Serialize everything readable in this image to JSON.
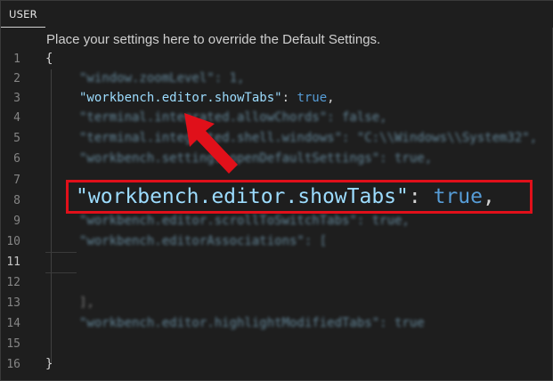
{
  "tab": {
    "label": "USER"
  },
  "hint": "Place your settings here to override the Default Settings.",
  "lines": [
    {
      "num": "1",
      "text": "{"
    },
    {
      "num": "2",
      "text": "\"window.zoomLevel\": 1,"
    },
    {
      "num": "3",
      "key": "\"workbench.editor.showTabs\"",
      "sep": ": ",
      "value": "true",
      "end": ","
    },
    {
      "num": "4",
      "text": "\"terminal.integrated.allowChords\": false,"
    },
    {
      "num": "5",
      "text": "\"terminal.integrated.shell.windows\": \"C:\\\\Windows\\\\System32\","
    },
    {
      "num": "6",
      "text": "\"workbench.settings.openDefaultSettings\": true,"
    },
    {
      "num": "7",
      "text": ""
    },
    {
      "num": "8",
      "text": ""
    },
    {
      "num": "9",
      "text": "\"workbench.editor.scrollToSwitchTabs\": true,"
    },
    {
      "num": "10",
      "text": "\"workbench.editorAssociations\": ["
    },
    {
      "num": "11",
      "text": ""
    },
    {
      "num": "12",
      "text": ""
    },
    {
      "num": "13",
      "text": "],"
    },
    {
      "num": "14",
      "text": "\"workbench.editor.highlightModifiedTabs\": true"
    },
    {
      "num": "15",
      "text": ""
    },
    {
      "num": "16",
      "text": "}"
    }
  ],
  "callout": {
    "key": "\"workbench.editor.showTabs\"",
    "sep": ": ",
    "value": "true",
    "end": ","
  },
  "colors": {
    "highlight_border": "#e0101a",
    "arrow": "#e0101a",
    "key": "#9cdcfe",
    "keyword": "#569cd6"
  }
}
